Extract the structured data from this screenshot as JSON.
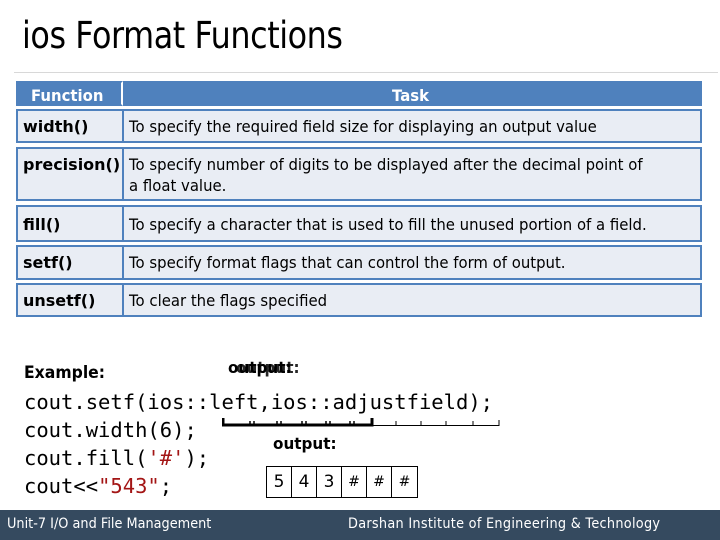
{
  "slide": {
    "title": "ios Format Functions"
  },
  "table": {
    "headers": {
      "function": "Function",
      "task": "Task"
    },
    "rows": [
      {
        "function": "width()",
        "task": "To specify the required field size for displaying an output value"
      },
      {
        "function": "precision()",
        "task_line1": "To specify number of digits to be displayed after the decimal point of",
        "task_line2": "a float value."
      },
      {
        "function": "fill()",
        "task": "To specify a character that is used to fill the unused portion of a field."
      },
      {
        "function": "setf()",
        "task": "To specify format flags that can control the form of output."
      },
      {
        "function": "unsetf()",
        "task": "To clear the flags specified"
      }
    ]
  },
  "example": {
    "label": "Example:",
    "code": {
      "line1": "cout.setf(ios::left,ios::adjustfield);",
      "line2": "cout.width(6);",
      "line3_pre": "cout.fill(",
      "line3_str": "'#'",
      "line3_post": ");",
      "line4_pre": "cout<<",
      "line4_str": "\"543\"",
      "line4_post": ";"
    },
    "overlapping_output_label": "output:",
    "output_label": "output:",
    "output_cells": [
      "5",
      "4",
      "3",
      "#",
      "#",
      "#"
    ]
  },
  "footer": {
    "left": "Unit-7 I/O and File Management",
    "right": "Darshan Institute of Engineering & Technology"
  },
  "colors": {
    "header_fill": "#4f81bd",
    "row_fill": "#e9edf4",
    "border": "#4f81bd",
    "string_literal": "#a31515",
    "footer_bg": "#354a5f"
  }
}
